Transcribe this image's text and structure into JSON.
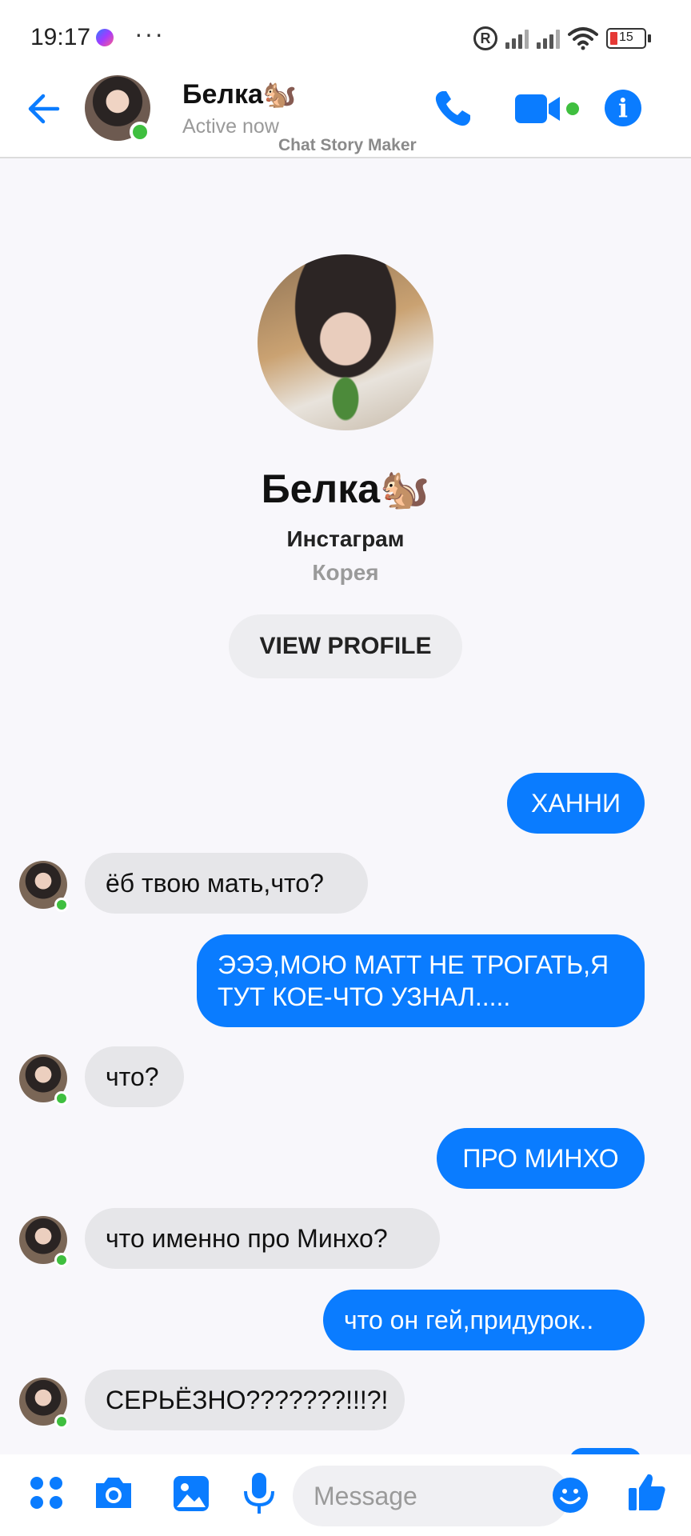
{
  "status_bar": {
    "time": "19:17",
    "dots": "···",
    "registered": "R",
    "battery": "15"
  },
  "header": {
    "name": "Белка🐿️",
    "status": "Active now",
    "watermark": "Chat Story Maker",
    "info": "i"
  },
  "profile": {
    "name": "Белка🐿️",
    "subtitle": "Инстаграм",
    "location": "Корея",
    "view_profile_label": "VIEW PROFILE"
  },
  "messages": [
    {
      "from": "me",
      "text": "ХАННИ"
    },
    {
      "from": "them",
      "text": "ёб твою мать,что?"
    },
    {
      "from": "me",
      "text": "ЭЭЭ,МОЮ МАТТ НЕ ТРОГАТЬ,Я ТУТ КОЕ-ЧТО УЗНАЛ....."
    },
    {
      "from": "them",
      "text": "что?"
    },
    {
      "from": "me",
      "text": "ПРО МИНХО"
    },
    {
      "from": "them",
      "text": "что именно про Минхо?"
    },
    {
      "from": "me",
      "text": "что он гей,придурок.."
    },
    {
      "from": "them",
      "text": "СЕРЬЁЗНО???????!!!?!"
    }
  ],
  "composer": {
    "placeholder": "Message"
  },
  "colors": {
    "accent": "#0a7cff",
    "online": "#3fbf3f",
    "incoming_bubble": "#e6e6e9",
    "background": "#f8f7fb"
  },
  "icons": [
    "messenger-icon",
    "registered-icon",
    "signal-icon",
    "wifi-icon",
    "battery-icon",
    "back-arrow-icon",
    "phone-icon",
    "video-camera-icon",
    "info-icon",
    "apps-grid-icon",
    "camera-icon",
    "gallery-icon",
    "microphone-icon",
    "emoji-icon",
    "thumbs-up-icon"
  ]
}
